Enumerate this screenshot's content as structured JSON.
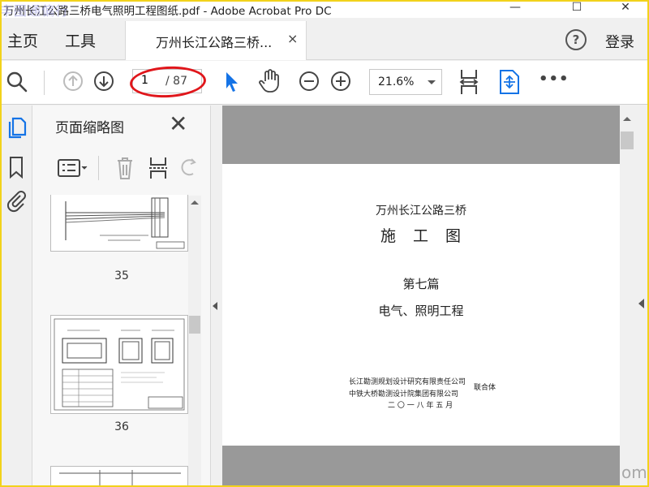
{
  "window": {
    "title": "万州长江公路三桥电气照明工程图纸.pdf - Adobe Acrobat Pro DC",
    "watermark": "丰图通偏行",
    "minimize": "—",
    "maximize": "☐",
    "close": "✕"
  },
  "tabs": {
    "home": "主页",
    "tools": "工具",
    "doc_tab": "万州长江公路三桥...",
    "close": "×",
    "help": "?",
    "signin": "登录"
  },
  "toolbar": {
    "page_current": "1",
    "page_total": "/ 87",
    "zoom": "21.6%",
    "more": "•••"
  },
  "panel": {
    "title": "页面缩略图",
    "close": "✕",
    "thumbnails": [
      {
        "number": "35"
      },
      {
        "number": "36"
      }
    ]
  },
  "page": {
    "project": "万州长江公路三桥",
    "doc_type": "施　工　图",
    "chapter": "第七篇",
    "section": "电气、照明工程",
    "company1": "长江勘测规划设计研究有限责任公司",
    "company2": "中铁大桥勘测设计院集团有限公司",
    "joint": "联合体",
    "date": "二 〇 一 八 年 五 月"
  },
  "corner_watermark": "om",
  "colors": {
    "accent_blue": "#1473e6",
    "annotation_red": "#e0161b",
    "frame_yellow": "#f2d21b"
  }
}
